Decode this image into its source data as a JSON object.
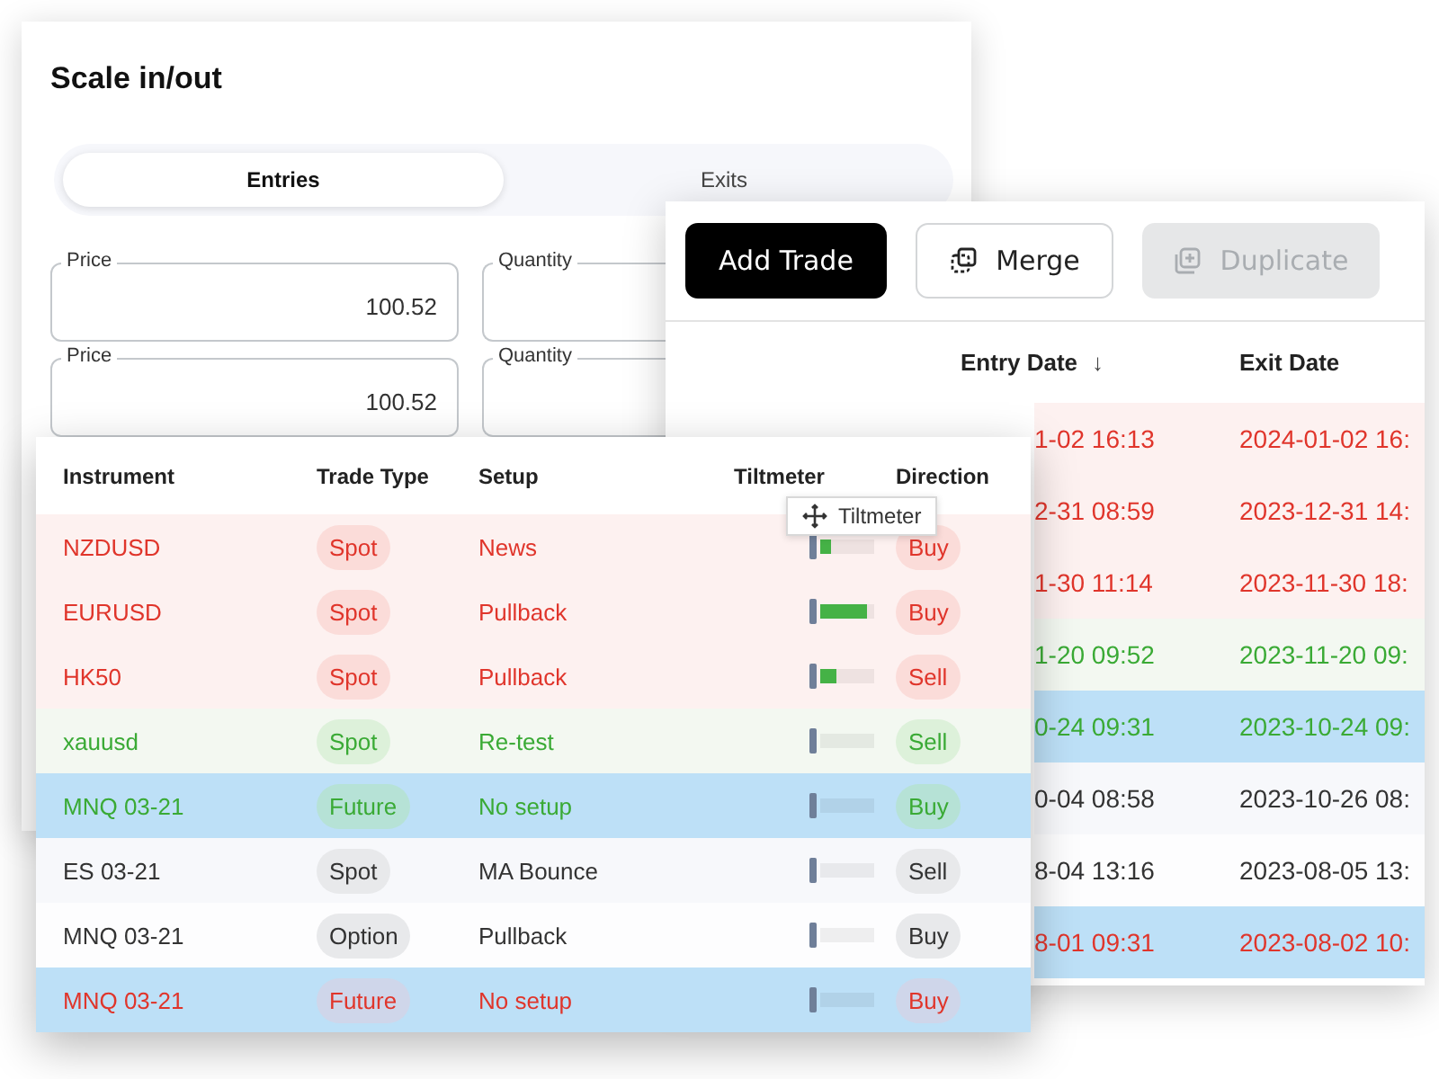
{
  "scale_card": {
    "title": "Scale in/out",
    "tabs": [
      {
        "label": "Entries",
        "selected": true
      },
      {
        "label": "Exits",
        "selected": false
      }
    ],
    "fields": [
      {
        "label": "Price",
        "value": "100.52",
        "kind": "full"
      },
      {
        "label": "Quantity",
        "kind": "partial"
      },
      {
        "label": "Price",
        "value": "100.52",
        "kind": "full"
      },
      {
        "label": "Quantity",
        "kind": "partial"
      }
    ]
  },
  "trades_card": {
    "buttons": [
      {
        "label": "Add Trade",
        "kind": "primary",
        "disabled": false
      },
      {
        "label": "Merge",
        "kind": "merge",
        "disabled": false
      },
      {
        "label": "Duplicate",
        "kind": "duplicate",
        "disabled": true
      }
    ],
    "columns": [
      {
        "label": "Entry Date",
        "sort_indicator": "↓"
      },
      {
        "label": "Exit Date"
      }
    ],
    "rows": [
      {
        "kind": "loss",
        "highlighted": false,
        "entry_date": "1-02 16:13",
        "exit_date": "2024-01-02 16:"
      },
      {
        "kind": "loss",
        "highlighted": false,
        "entry_date": "2-31 08:59",
        "exit_date": "2023-12-31 14:"
      },
      {
        "kind": "loss",
        "highlighted": false,
        "entry_date": "1-30 11:14",
        "exit_date": "2023-11-30 18:"
      },
      {
        "kind": "win",
        "highlighted": false,
        "entry_date": "1-20 09:52",
        "exit_date": "2023-11-20 09:"
      },
      {
        "kind": "win",
        "highlighted": true,
        "entry_date": "0-24 09:31",
        "exit_date": "2023-10-24 09:"
      },
      {
        "kind": "neutral",
        "highlighted": false,
        "entry_date": "0-04 08:58",
        "exit_date": "2023-10-26 08:"
      },
      {
        "kind": "neutral",
        "highlighted": false,
        "entry_date": "8-04 13:16",
        "exit_date": "2023-08-05 13:"
      },
      {
        "kind": "loss",
        "highlighted": true,
        "entry_date": "8-01 09:31",
        "exit_date": "2023-08-02 10:"
      }
    ]
  },
  "journal_table": {
    "columns": [
      "Instrument",
      "Trade Type",
      "Setup",
      "Tiltmeter",
      "Direction"
    ],
    "rows": [
      {
        "kind": "loss",
        "highlighted": false,
        "instrument": "NZDUSD",
        "trade_type": "Spot",
        "setup": "News",
        "level": 0.2,
        "direction": "Buy"
      },
      {
        "kind": "loss",
        "highlighted": false,
        "instrument": "EURUSD",
        "trade_type": "Spot",
        "setup": "Pullback",
        "level": 0.85,
        "direction": "Buy"
      },
      {
        "kind": "loss",
        "highlighted": false,
        "instrument": "HK50",
        "trade_type": "Spot",
        "setup": "Pullback",
        "level": 0.3,
        "direction": "Sell"
      },
      {
        "kind": "win",
        "highlighted": false,
        "instrument": "xauusd",
        "trade_type": "Spot",
        "setup": "Re-test",
        "direction": "Sell"
      },
      {
        "kind": "win",
        "highlighted": true,
        "instrument": "MNQ 03-21",
        "trade_type": "Future",
        "setup": "No setup",
        "direction": "Buy"
      },
      {
        "kind": "neutral",
        "highlighted": false,
        "instrument": "ES 03-21",
        "trade_type": "Spot",
        "setup": "MA Bounce",
        "direction": "Sell"
      },
      {
        "kind": "neutral",
        "highlighted": false,
        "instrument": "MNQ 03-21",
        "trade_type": "Option",
        "setup": "Pullback",
        "direction": "Buy"
      },
      {
        "kind": "loss",
        "highlighted": true,
        "instrument": "MNQ 03-21",
        "trade_type": "Future",
        "setup": "No setup",
        "direction": "Buy"
      }
    ],
    "tooltip": {
      "label": "Tiltmeter"
    }
  }
}
